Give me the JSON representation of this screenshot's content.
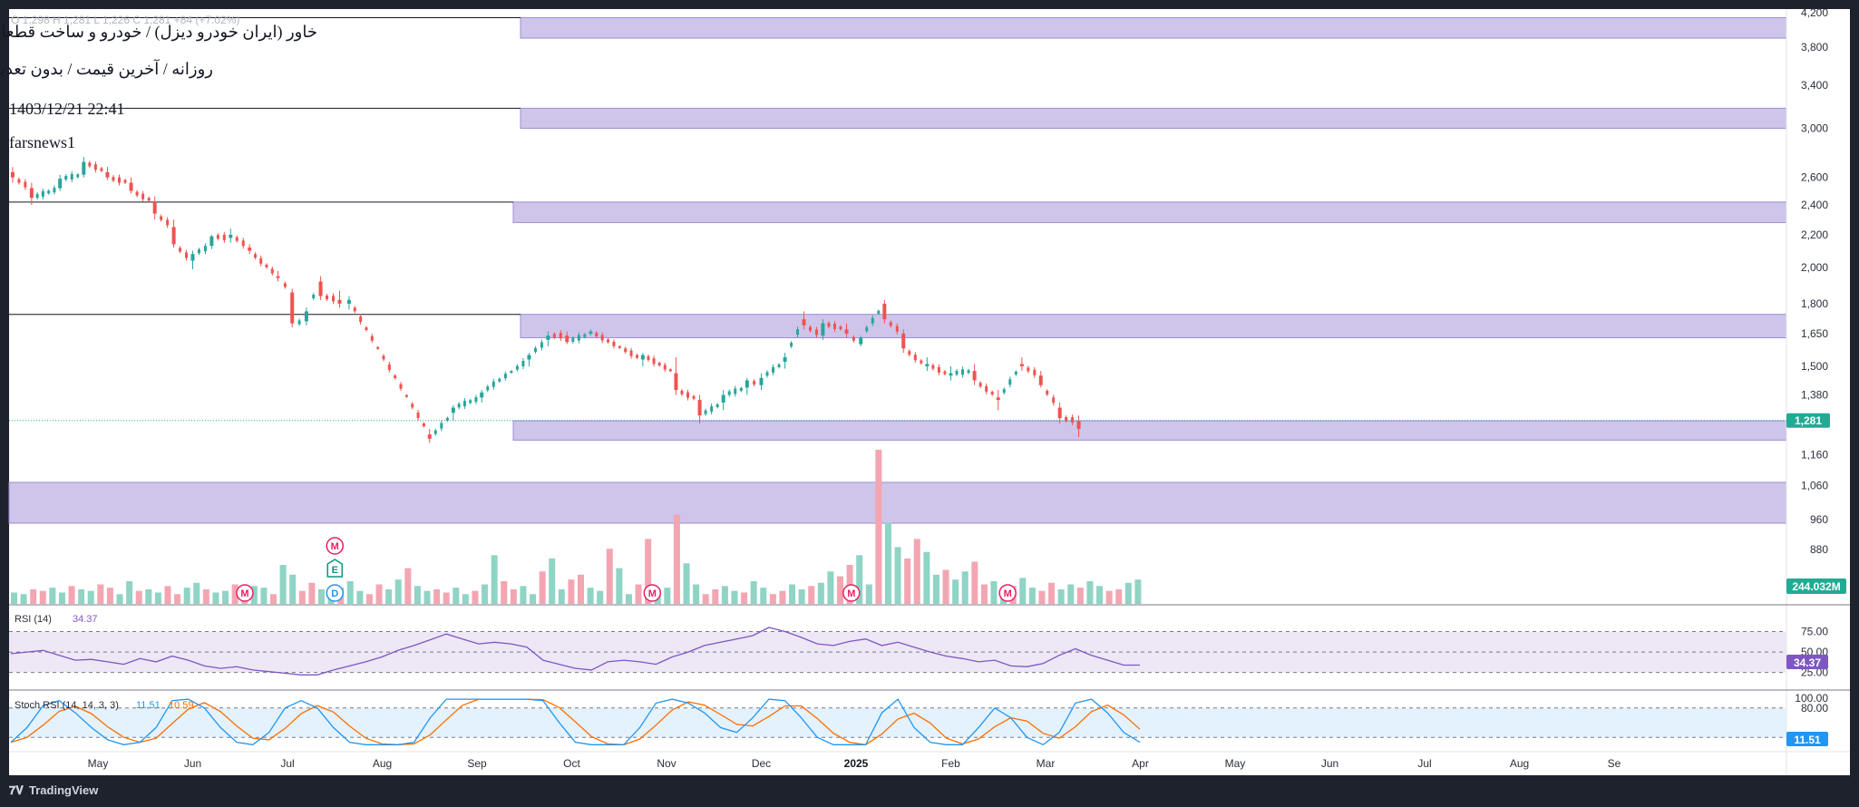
{
  "header": {
    "faded_ohlc": "O 1,298 H 1,281 L 1,226 C 1,281 +84 (+7.02%)",
    "symbol_line": "خاور (ایران خودرو دیزل) / خودرو و ساخت قطعات",
    "interval_line": "روزانه / آخرین قیمت / بدون تعدیل",
    "datetime": "1403/12/21 22:41",
    "author": "farsnews1"
  },
  "price_axis": {
    "ticks": [
      4200,
      3800,
      3400,
      3000,
      2600,
      2400,
      2200,
      2000,
      1800,
      1650,
      1500,
      1380,
      1280,
      1160,
      1060,
      960,
      880
    ],
    "labels": [
      "4,200",
      "3,800",
      "3,400",
      "3,000",
      "2,600",
      "2,400",
      "2,200",
      "2,000",
      "1,800",
      "1,650",
      "1,500",
      "1,380",
      "1,280",
      "1,160",
      "1,060",
      "960",
      "880"
    ],
    "scale": "log",
    "last_price": 1281,
    "last_price_label": "1,281",
    "volume_label": "244.032M",
    "colors": {
      "last_price_badge": "#22ab94",
      "volume_badge": "#22ab94"
    }
  },
  "time_axis": {
    "labels": [
      {
        "text": "May",
        "month_index": 0,
        "bold": false
      },
      {
        "text": "Jun",
        "month_index": 1,
        "bold": false
      },
      {
        "text": "Jul",
        "month_index": 2,
        "bold": false
      },
      {
        "text": "Aug",
        "month_index": 3,
        "bold": false
      },
      {
        "text": "Sep",
        "month_index": 4,
        "bold": false
      },
      {
        "text": "Oct",
        "month_index": 5,
        "bold": false
      },
      {
        "text": "Nov",
        "month_index": 6,
        "bold": false
      },
      {
        "text": "Dec",
        "month_index": 7,
        "bold": false
      },
      {
        "text": "2025",
        "month_index": 8,
        "bold": true
      },
      {
        "text": "Feb",
        "month_index": 9,
        "bold": false
      },
      {
        "text": "Mar",
        "month_index": 10,
        "bold": false
      },
      {
        "text": "Apr",
        "month_index": 11,
        "bold": false
      },
      {
        "text": "May",
        "month_index": 12,
        "bold": false
      },
      {
        "text": "Jun",
        "month_index": 13,
        "bold": false
      },
      {
        "text": "Jul",
        "month_index": 14,
        "bold": false
      },
      {
        "text": "Aug",
        "month_index": 15,
        "bold": false
      },
      {
        "text": "Se",
        "month_index": 16,
        "bold": false
      }
    ]
  },
  "zones": [
    {
      "low": 3900,
      "high": 4140,
      "color": "#cfc5ea"
    },
    {
      "low": 3000,
      "high": 3180,
      "color": "#cfc5ea"
    },
    {
      "low": 2280,
      "high": 2420,
      "color": "#cfc5ea"
    },
    {
      "low": 1630,
      "high": 1745,
      "color": "#cfc5ea"
    },
    {
      "low": 1210,
      "high": 1280,
      "color": "#cfc5ea"
    },
    {
      "low": 950,
      "high": 1070,
      "color": "#cfc5ea"
    }
  ],
  "horizontal_lines": [
    4140,
    3180,
    2420,
    1745
  ],
  "chart_data": {
    "type": "candlestick",
    "x_unit": "month index (0 = May 2024)",
    "y_scale": "log",
    "ylim": [
      880,
      4220
    ],
    "ohlc_series": [
      {
        "x": -0.9,
        "o": 2640,
        "h": 2680,
        "l": 2560,
        "c": 2600
      },
      {
        "x": -0.7,
        "o": 2520,
        "h": 2560,
        "l": 2400,
        "c": 2450
      },
      {
        "x": -0.4,
        "o": 2520,
        "h": 2620,
        "l": 2500,
        "c": 2590
      },
      {
        "x": -0.15,
        "o": 2620,
        "h": 2760,
        "l": 2600,
        "c": 2720
      },
      {
        "x": 0.1,
        "o": 2640,
        "h": 2680,
        "l": 2580,
        "c": 2600
      },
      {
        "x": 0.35,
        "o": 2560,
        "h": 2600,
        "l": 2480,
        "c": 2500
      },
      {
        "x": 0.6,
        "o": 2420,
        "h": 2460,
        "l": 2300,
        "c": 2340
      },
      {
        "x": 0.8,
        "o": 2250,
        "h": 2300,
        "l": 2120,
        "c": 2140
      },
      {
        "x": 1.0,
        "o": 2040,
        "h": 2100,
        "l": 1990,
        "c": 2080
      },
      {
        "x": 1.2,
        "o": 2130,
        "h": 2200,
        "l": 2110,
        "c": 2190
      },
      {
        "x": 1.4,
        "o": 2180,
        "h": 2240,
        "l": 2150,
        "c": 2200
      },
      {
        "x": 1.6,
        "o": 2120,
        "h": 2140,
        "l": 2080,
        "c": 2100
      },
      {
        "x": 1.9,
        "o": 1950,
        "h": 1980,
        "l": 1920,
        "c": 1940
      },
      {
        "x": 2.05,
        "o": 1860,
        "h": 1880,
        "l": 1680,
        "c": 1700
      },
      {
        "x": 2.2,
        "o": 1710,
        "h": 1780,
        "l": 1690,
        "c": 1760
      },
      {
        "x": 2.35,
        "o": 1920,
        "h": 1950,
        "l": 1820,
        "c": 1840
      },
      {
        "x": 2.55,
        "o": 1820,
        "h": 1870,
        "l": 1780,
        "c": 1800
      },
      {
        "x": 2.65,
        "o": 1800,
        "h": 1840,
        "l": 1770,
        "c": 1820
      },
      {
        "x": 2.65,
        "o": 1800,
        "h": 1840,
        "l": 1770,
        "c": 1820
      },
      {
        "x": 2.65,
        "o": 1800,
        "h": 1840,
        "l": 1770,
        "c": 1820
      },
      {
        "x": 2.65,
        "o": 1800,
        "h": 1840,
        "l": 1770,
        "c": 1820
      },
      {
        "x": 2.65,
        "o": 1800,
        "h": 1840,
        "l": 1770,
        "c": 1820
      },
      {
        "x": 2.65,
        "o": 1800,
        "h": 1840,
        "l": 1770,
        "c": 1820
      },
      {
        "x": 2.65,
        "o": 1800,
        "h": 1840,
        "l": 1770,
        "c": 1820
      },
      {
        "x": 2.65,
        "o": 1800,
        "h": 1840,
        "l": 1770,
        "c": 1820
      },
      {
        "x": 2.65,
        "o": 1800,
        "h": 1840,
        "l": 1770,
        "c": 1820
      },
      {
        "x": 3.5,
        "o": 1230,
        "h": 1250,
        "l": 1200,
        "c": 1215
      },
      {
        "x": 3.75,
        "o": 1310,
        "h": 1340,
        "l": 1280,
        "c": 1330
      },
      {
        "x": 4.05,
        "o": 1370,
        "h": 1400,
        "l": 1350,
        "c": 1390
      },
      {
        "x": 4.55,
        "o": 1530,
        "h": 1560,
        "l": 1500,
        "c": 1550
      },
      {
        "x": 4.75,
        "o": 1620,
        "h": 1660,
        "l": 1590,
        "c": 1640
      },
      {
        "x": 4.95,
        "o": 1640,
        "h": 1660,
        "l": 1600,
        "c": 1610
      },
      {
        "x": 5.2,
        "o": 1650,
        "h": 1670,
        "l": 1640,
        "c": 1660
      },
      {
        "x": 5.75,
        "o": 1530,
        "h": 1560,
        "l": 1500,
        "c": 1550
      },
      {
        "x": 6.1,
        "o": 1470,
        "h": 1540,
        "l": 1380,
        "c": 1400
      },
      {
        "x": 6.35,
        "o": 1360,
        "h": 1380,
        "l": 1270,
        "c": 1300
      },
      {
        "x": 6.6,
        "o": 1350,
        "h": 1400,
        "l": 1320,
        "c": 1380
      },
      {
        "x": 6.85,
        "o": 1410,
        "h": 1450,
        "l": 1380,
        "c": 1440
      },
      {
        "x": 7.0,
        "o": 1420,
        "h": 1470,
        "l": 1400,
        "c": 1450
      },
      {
        "x": 7.25,
        "o": 1520,
        "h": 1560,
        "l": 1490,
        "c": 1540
      },
      {
        "x": 7.45,
        "o": 1720,
        "h": 1760,
        "l": 1670,
        "c": 1690
      },
      {
        "x": 7.65,
        "o": 1640,
        "h": 1720,
        "l": 1620,
        "c": 1700
      },
      {
        "x": 7.9,
        "o": 1670,
        "h": 1700,
        "l": 1630,
        "c": 1650
      },
      {
        "x": 8.05,
        "o": 1600,
        "h": 1640,
        "l": 1590,
        "c": 1630
      },
      {
        "x": 8.3,
        "o": 1800,
        "h": 1820,
        "l": 1700,
        "c": 1720
      },
      {
        "x": 8.5,
        "o": 1650,
        "h": 1670,
        "l": 1560,
        "c": 1580
      },
      {
        "x": 8.75,
        "o": 1500,
        "h": 1540,
        "l": 1480,
        "c": 1510
      },
      {
        "x": 9.0,
        "o": 1460,
        "h": 1500,
        "l": 1440,
        "c": 1470
      },
      {
        "x": 9.25,
        "o": 1480,
        "h": 1510,
        "l": 1420,
        "c": 1440
      },
      {
        "x": 9.5,
        "o": 1370,
        "h": 1400,
        "l": 1320,
        "c": 1360
      },
      {
        "x": 9.75,
        "o": 1510,
        "h": 1540,
        "l": 1480,
        "c": 1500
      },
      {
        "x": 9.95,
        "o": 1460,
        "h": 1480,
        "l": 1410,
        "c": 1420
      },
      {
        "x": 10.15,
        "o": 1330,
        "h": 1350,
        "l": 1270,
        "c": 1290
      },
      {
        "x": 10.35,
        "o": 1280,
        "h": 1300,
        "l": 1220,
        "c": 1250
      }
    ]
  },
  "rsi": {
    "label": "RSI (14)",
    "value_label": "34.37",
    "levels": [
      "75.00",
      "50.00",
      "25.00"
    ],
    "line_color": "#7e57c2",
    "band_color": "#ede7f6",
    "values": [
      48,
      50,
      52,
      46,
      40,
      41,
      38,
      35,
      42,
      38,
      45,
      40,
      33,
      30,
      32,
      28,
      26,
      24,
      22,
      22,
      28,
      33,
      38,
      44,
      52,
      58,
      65,
      72,
      66,
      60,
      62,
      60,
      56,
      40,
      35,
      30,
      28,
      38,
      40,
      38,
      35,
      44,
      50,
      58,
      62,
      66,
      70,
      80,
      75,
      68,
      60,
      58,
      63,
      66,
      58,
      62,
      56,
      50,
      45,
      42,
      38,
      40,
      33,
      32,
      36,
      46,
      54,
      46,
      40,
      34,
      34
    ]
  },
  "stoch": {
    "label": "Stoch RSI (14, 14, 3, 3)",
    "k_label": "11.51",
    "d_label": "10.59",
    "levels": [
      "100.00",
      "80.00",
      "20.00"
    ],
    "k_color": "#2196f3",
    "d_color": "#ff6d00",
    "band_color": "#e3f2fd",
    "value_label": "11.51",
    "k_values": [
      10,
      40,
      85,
      95,
      70,
      40,
      15,
      5,
      10,
      40,
      95,
      98,
      80,
      40,
      10,
      5,
      30,
      80,
      95,
      80,
      40,
      10,
      5,
      5,
      5,
      10,
      60,
      98,
      98,
      98,
      98,
      98,
      98,
      95,
      50,
      10,
      5,
      5,
      5,
      40,
      90,
      98,
      90,
      70,
      40,
      30,
      60,
      98,
      95,
      60,
      20,
      5,
      5,
      5,
      70,
      98,
      40,
      10,
      5,
      5,
      40,
      80,
      60,
      20,
      5,
      30,
      90,
      98,
      70,
      30,
      10
    ]
  },
  "volume": {
    "up_color": "#8fd4c5",
    "down_color": "#f3a6b2",
    "values": [
      7,
      6,
      9,
      8,
      10,
      7,
      11,
      9,
      8,
      12,
      10,
      6,
      14,
      8,
      9,
      7,
      11,
      6,
      10,
      13,
      9,
      7,
      8,
      12,
      9,
      11,
      10,
      6,
      24,
      18,
      8,
      13,
      9,
      7,
      10,
      14,
      8,
      6,
      12,
      9,
      15,
      22,
      11,
      8,
      9,
      7,
      10,
      6,
      8,
      12,
      30,
      14,
      9,
      11,
      6,
      20,
      28,
      9,
      15,
      18,
      10,
      8,
      34,
      22,
      6,
      12,
      40,
      9,
      10,
      55,
      25,
      12,
      6,
      9,
      11,
      8,
      7,
      14,
      10,
      6,
      8,
      12,
      9,
      11,
      13,
      20,
      17,
      24,
      30,
      12,
      95,
      50,
      35,
      28,
      40,
      32,
      18,
      21,
      15,
      20,
      26,
      12,
      14,
      9,
      11,
      16,
      10,
      8,
      13,
      9,
      12,
      10,
      14,
      11,
      8,
      9,
      13,
      15
    ],
    "markers": [
      {
        "letter": "M",
        "x": 1.55,
        "kind": "event"
      },
      {
        "letter": "M",
        "x": 2.5,
        "kind": "event",
        "stack": 2
      },
      {
        "letter": "E",
        "x": 2.5,
        "kind": "earnings",
        "stack": 1
      },
      {
        "letter": "D",
        "x": 2.5,
        "kind": "dividend",
        "stack": 0
      },
      {
        "letter": "M",
        "x": 5.85,
        "kind": "event"
      },
      {
        "letter": "M",
        "x": 7.95,
        "kind": "event"
      },
      {
        "letter": "M",
        "x": 9.6,
        "kind": "event"
      }
    ]
  },
  "footer": {
    "brand": "TradingView"
  }
}
